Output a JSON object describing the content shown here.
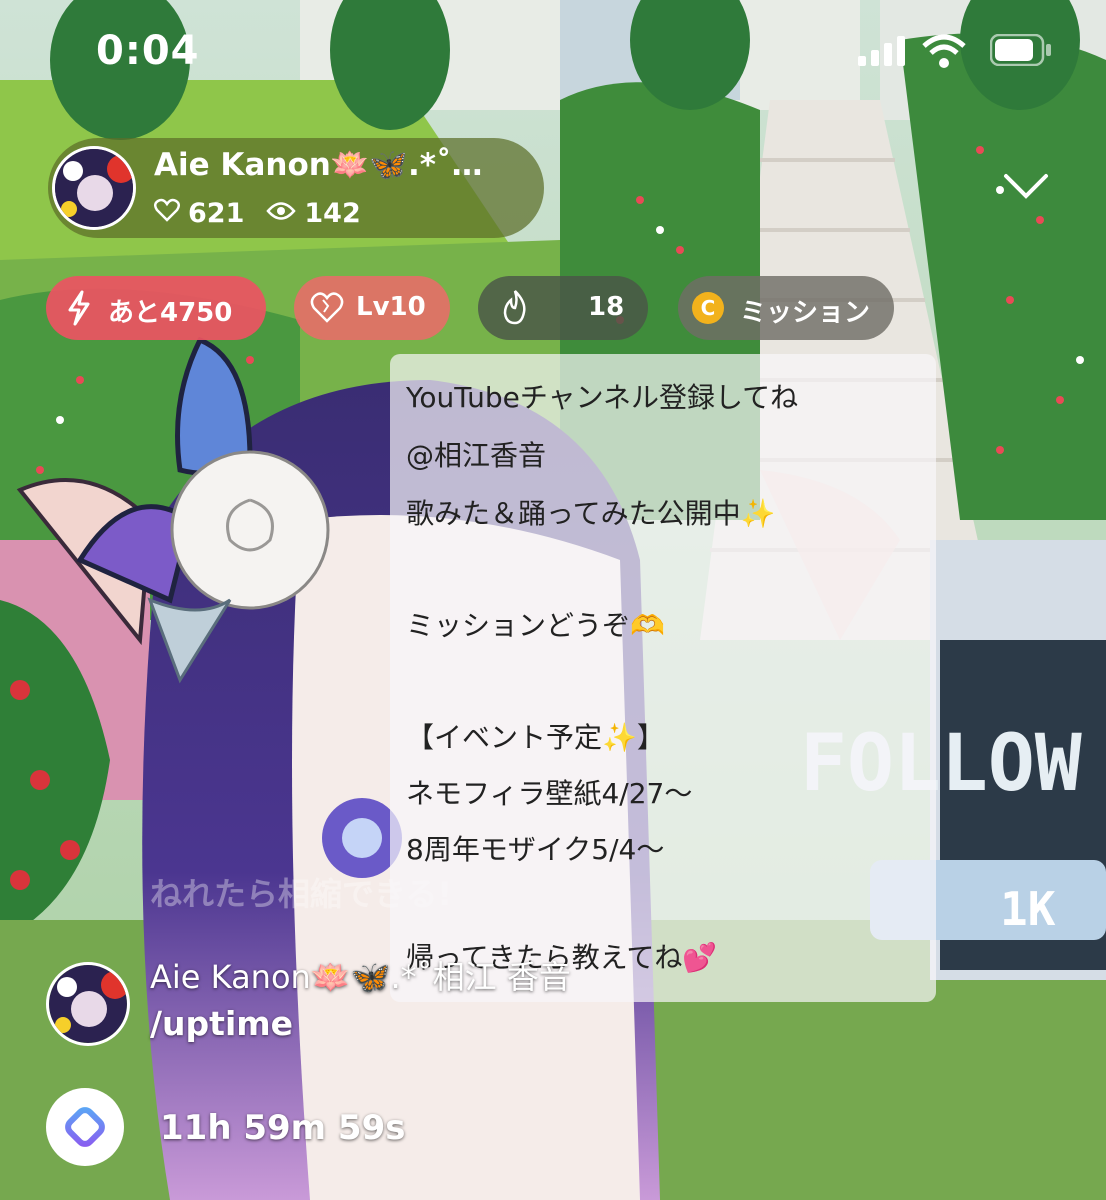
{
  "status_bar": {
    "time": "0:04",
    "icons": [
      "cellular-signal-icon",
      "wifi-icon",
      "battery-icon"
    ]
  },
  "host": {
    "name": "Aie Kanon🪷🦋.*˚…",
    "likes": "621",
    "viewers": "142",
    "icons": [
      "heart-icon",
      "eye-icon"
    ]
  },
  "chips": {
    "boost": {
      "label": "あと4750",
      "icon": "lightning-icon"
    },
    "level": {
      "label": "Lv10",
      "icon": "heart-level-icon"
    },
    "fire": {
      "label": "18",
      "icon": "flame-icon"
    },
    "mission": {
      "label": "ミッション",
      "icon": "coin-icon",
      "coin_letter": "C"
    }
  },
  "notice": {
    "lines": [
      "YouTubeチャンネル登録してね",
      "@相江香音",
      "歌みた＆踊ってみた公開中✨",
      "",
      "ミッションどうぞ🫶",
      "",
      "【イベント予定✨】",
      "ネモフィラ壁紙4/27〜",
      "8周年モザイク5/4〜",
      "",
      "帰ってきたら教えてね💕"
    ]
  },
  "background_text": {
    "banner": "FOLLOW",
    "counter": "1K",
    "faded_chat": "ねれたら相縮できる!"
  },
  "chat": [
    {
      "name": "Aie Kanon🪷🦋.*˚相江 香音",
      "message": "/uptime"
    }
  ],
  "bot": {
    "message": "11h 59m 59s"
  },
  "colors": {
    "boost": "#ec5462",
    "level": "#e66e68",
    "coin": "#f2b21c",
    "pill": "#5c6e28"
  }
}
